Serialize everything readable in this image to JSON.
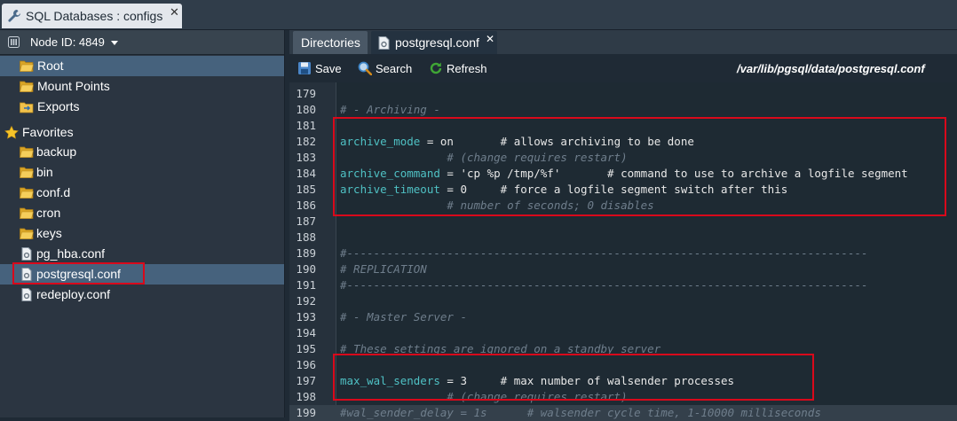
{
  "window": {
    "tab_title": "SQL Databases : configs",
    "close_glyph": "✕"
  },
  "left_panel": {
    "node_label": "Node ID: 4849",
    "tree": [
      {
        "label": "Root",
        "icon": "folder-open-icon",
        "selected": true
      },
      {
        "label": "Mount Points",
        "icon": "folder-open-icon"
      },
      {
        "label": "Exports",
        "icon": "exports-icon"
      },
      {
        "label": "Favorites",
        "icon": "star-icon"
      },
      {
        "label": "backup",
        "icon": "folder-open-icon"
      },
      {
        "label": "bin",
        "icon": "folder-open-icon"
      },
      {
        "label": "conf.d",
        "icon": "folder-open-icon"
      },
      {
        "label": "cron",
        "icon": "folder-open-icon"
      },
      {
        "label": "keys",
        "icon": "folder-open-icon"
      },
      {
        "label": "pg_hba.conf",
        "icon": "config-file-icon"
      },
      {
        "label": "postgresql.conf",
        "icon": "config-file-icon",
        "selected": true
      },
      {
        "label": "redeploy.conf",
        "icon": "config-file-icon"
      }
    ]
  },
  "right_panel": {
    "tabs": [
      {
        "label": "Directories"
      },
      {
        "label": "postgresql.conf",
        "active": true,
        "close_glyph": "✕"
      }
    ],
    "toolbar": {
      "save_label": "Save",
      "search_label": "Search",
      "refresh_label": "Refresh",
      "path": "/var/lib/pgsql/data/postgresql.conf"
    }
  },
  "editor": {
    "lines": [
      {
        "num": "179",
        "text": ""
      },
      {
        "num": "180",
        "text": "# - Archiving -"
      },
      {
        "num": "181",
        "text": ""
      },
      {
        "num": "182",
        "text": "archive_mode = on       # allows archiving to be done"
      },
      {
        "num": "183",
        "text": "                # (change requires restart)"
      },
      {
        "num": "184",
        "text": "archive_command = 'cp %p /tmp/%f'       # command to use to archive a logfile segment"
      },
      {
        "num": "185",
        "text": "archive_timeout = 0     # force a logfile segment switch after this"
      },
      {
        "num": "186",
        "text": "                # number of seconds; 0 disables"
      },
      {
        "num": "187",
        "text": ""
      },
      {
        "num": "188",
        "text": ""
      },
      {
        "num": "189",
        "text": "#------------------------------------------------------------------------------"
      },
      {
        "num": "190",
        "text": "# REPLICATION"
      },
      {
        "num": "191",
        "text": "#------------------------------------------------------------------------------"
      },
      {
        "num": "192",
        "text": ""
      },
      {
        "num": "193",
        "text": "# - Master Server -"
      },
      {
        "num": "194",
        "text": ""
      },
      {
        "num": "195",
        "text": "# These settings are ignored on a standby server"
      },
      {
        "num": "196",
        "text": ""
      },
      {
        "num": "197",
        "text": "max_wal_senders = 3     # max number of walsender processes"
      },
      {
        "num": "198",
        "text": "                # (change requires restart)"
      },
      {
        "num": "199",
        "text": "#wal_sender_delay = 1s      # walsender cycle time, 1-10000 milliseconds"
      }
    ],
    "current_line": "199"
  },
  "colors": {
    "keyword": "#4fc1c4",
    "comment": "#6f7e8c",
    "highlight_box": "#d9091b",
    "selection": "#46627d"
  }
}
